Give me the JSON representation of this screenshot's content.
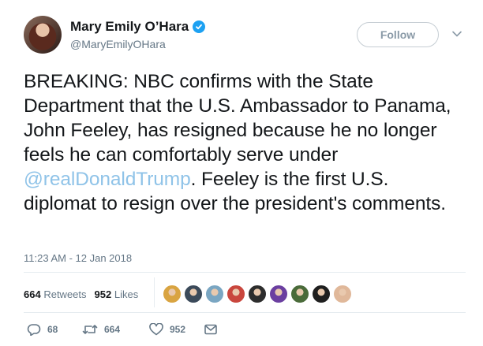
{
  "author": {
    "display_name": "Mary Emily O’Hara",
    "handle": "@MaryEmilyOHara",
    "verified": true
  },
  "follow_button": {
    "label": "Follow"
  },
  "tweet": {
    "text_before": "BREAKING: NBC confirms with the State Department that the U.S. Ambassador to Panama, John Feeley, has resigned because he no longer feels he can comfortably serve under ",
    "mention": "@realDonaldTrump",
    "text_after": ". Feeley is the first U.S. diplomat to resign over the president's comments.",
    "timestamp": "11:23 AM - 12 Jan 2018"
  },
  "stats": {
    "retweets_count": "664",
    "retweets_label": "Retweets",
    "likes_count": "952",
    "likes_label": "Likes"
  },
  "liker_avatars": [
    "#d9a441",
    "#3b4a5a",
    "#7aa6c2",
    "#c9463d",
    "#2d2d2d",
    "#6b3fa0",
    "#4a6b3a",
    "#1f1f1f",
    "#e0b89a"
  ],
  "actions": {
    "reply_count": "68",
    "retweet_count": "664",
    "like_count": "952"
  },
  "colors": {
    "accent": "#1da1f2",
    "mention": "#8fc3e8",
    "muted": "#657786"
  }
}
